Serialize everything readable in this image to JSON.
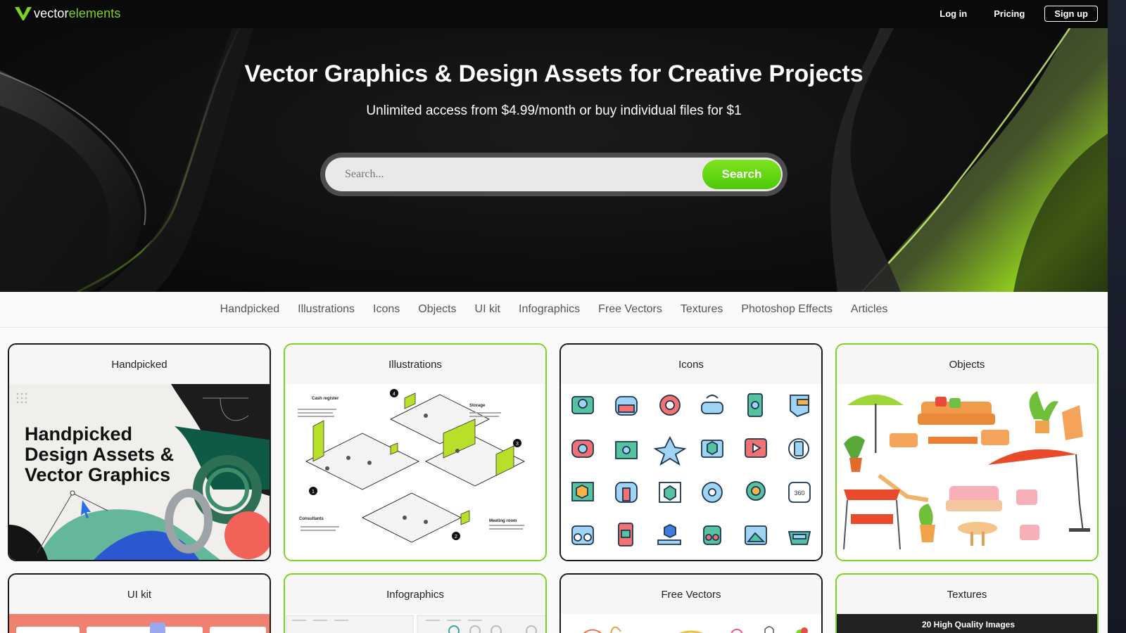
{
  "topbar": {
    "logo_prefix": "vector",
    "logo_suffix": "elements",
    "login_label": "Log in",
    "pricing_label": "Pricing",
    "signup_label": "Sign up"
  },
  "hero": {
    "title": "Vector Graphics & Design Assets for Creative Projects",
    "subtitle": "Unlimited access from $4.99/month or buy individual files for $1",
    "search_placeholder": "Search...",
    "search_button": "Search"
  },
  "category_nav": [
    "Handpicked",
    "Illustrations",
    "Icons",
    "Objects",
    "UI kit",
    "Infographics",
    "Free Vectors",
    "Textures",
    "Photoshop Effects",
    "Articles"
  ],
  "cards": [
    {
      "title": "Handpicked",
      "art_text": "Handpicked\nDesign Assets &\nVector Graphics"
    },
    {
      "title": "Illustrations",
      "labels": [
        "Cash register",
        "Storage",
        "Consultants",
        "Meeting room"
      ],
      "markers": [
        "4",
        "3",
        "1",
        "2"
      ]
    },
    {
      "title": "Icons"
    },
    {
      "title": "Objects"
    },
    {
      "title": "UI kit"
    },
    {
      "title": "Infographics"
    },
    {
      "title": "Free Vectors"
    },
    {
      "title": "Textures",
      "caption": "20 High Quality Images"
    }
  ],
  "colors": {
    "accent": "#7ed321",
    "topbar": "#0a0a0a",
    "hero_bg": "#0f0f0f",
    "search_button": "#5ccf12"
  }
}
